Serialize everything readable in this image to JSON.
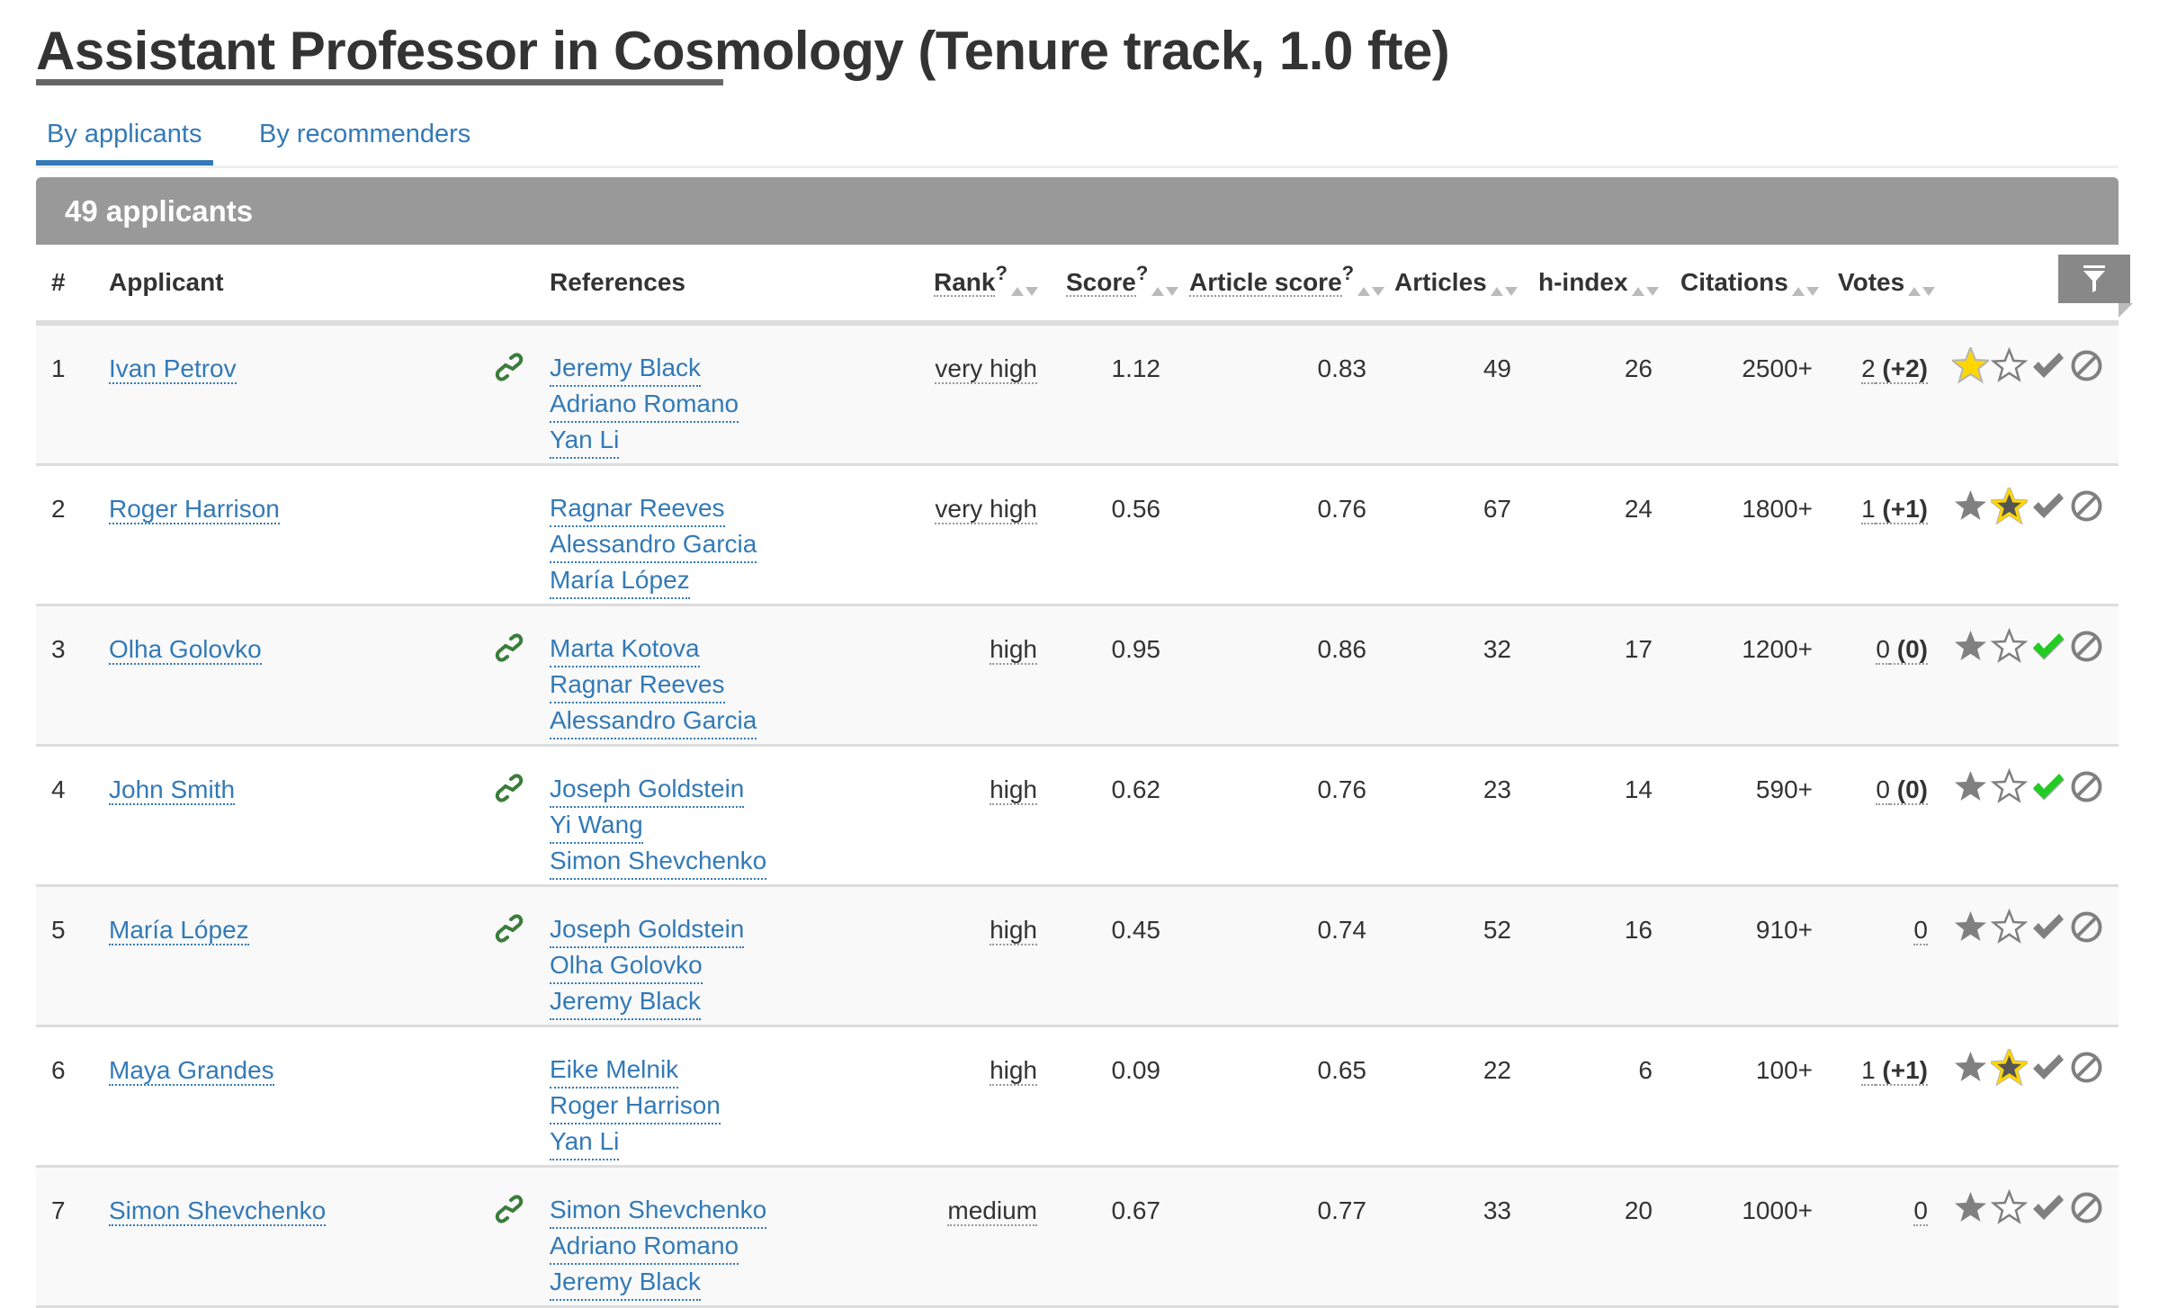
{
  "page": {
    "title": "Assistant Professor in Cosmology (Tenure track, 1.0 fte)",
    "tabs": [
      {
        "label": "By applicants",
        "active": true
      },
      {
        "label": "By recommenders",
        "active": false
      }
    ],
    "applicant_count_label": "49 applicants"
  },
  "colors": {
    "link": "#337ab7",
    "link_icon": "#3a7d3a",
    "star_yellow": "#ffd700",
    "check_green": "#22cc22",
    "icon_grey": "#808080",
    "header_bar": "#999999"
  },
  "table": {
    "headers": {
      "num": "#",
      "applicant": "Applicant",
      "references": "References",
      "rank": "Rank",
      "score": "Score",
      "article_score": "Article score",
      "articles": "Articles",
      "hindex": "h-index",
      "citations": "Citations",
      "votes": "Votes",
      "help_mark": "?"
    },
    "filter_icon": "filter-icon",
    "rows": [
      {
        "num": "1",
        "name": "Ivan Petrov",
        "has_link": true,
        "refs": [
          "Jeremy Black",
          "Adriano Romano",
          "Yan Li"
        ],
        "rank": "very high",
        "score": "1.12",
        "article_score": "0.83",
        "articles": "49",
        "hindex": "26",
        "citations": "2500+",
        "votes": "2",
        "votes_delta": "(+2)",
        "star_full": "yellow",
        "star_outline": "grey",
        "check": "grey"
      },
      {
        "num": "2",
        "name": "Roger Harrison",
        "has_link": false,
        "refs": [
          "Ragnar Reeves",
          "Alessandro Garcia",
          "María López"
        ],
        "rank": "very high",
        "score": "0.56",
        "article_score": "0.76",
        "articles": "67",
        "hindex": "24",
        "citations": "1800+",
        "votes": "1",
        "votes_delta": "(+1)",
        "star_full": "grey",
        "star_outline": "yellow",
        "check": "grey"
      },
      {
        "num": "3",
        "name": "Olha Golovko",
        "has_link": true,
        "refs": [
          "Marta Kotova",
          "Ragnar Reeves",
          "Alessandro Garcia"
        ],
        "rank": "high",
        "score": "0.95",
        "article_score": "0.86",
        "articles": "32",
        "hindex": "17",
        "citations": "1200+",
        "votes": "0",
        "votes_delta": "(0)",
        "star_full": "grey",
        "star_outline": "grey",
        "check": "green"
      },
      {
        "num": "4",
        "name": "John Smith",
        "has_link": true,
        "refs": [
          "Joseph Goldstein",
          "Yi Wang",
          "Simon Shevchenko"
        ],
        "rank": "high",
        "score": "0.62",
        "article_score": "0.76",
        "articles": "23",
        "hindex": "14",
        "citations": "590+",
        "votes": "0",
        "votes_delta": "(0)",
        "star_full": "grey",
        "star_outline": "grey",
        "check": "green"
      },
      {
        "num": "5",
        "name": "María López",
        "has_link": true,
        "refs": [
          "Joseph Goldstein",
          "Olha Golovko",
          "Jeremy Black"
        ],
        "rank": "high",
        "score": "0.45",
        "article_score": "0.74",
        "articles": "52",
        "hindex": "16",
        "citations": "910+",
        "votes": "0",
        "votes_delta": "",
        "star_full": "grey",
        "star_outline": "grey",
        "check": "grey"
      },
      {
        "num": "6",
        "name": "Maya Grandes",
        "has_link": false,
        "refs": [
          "Eike Melnik",
          "Roger Harrison",
          "Yan Li"
        ],
        "rank": "high",
        "score": "0.09",
        "article_score": "0.65",
        "articles": "22",
        "hindex": "6",
        "citations": "100+",
        "votes": "1",
        "votes_delta": "(+1)",
        "star_full": "grey",
        "star_outline": "yellow",
        "check": "grey"
      },
      {
        "num": "7",
        "name": "Simon Shevchenko",
        "has_link": true,
        "refs": [
          "Simon Shevchenko",
          "Adriano Romano",
          "Jeremy Black"
        ],
        "rank": "medium",
        "score": "0.67",
        "article_score": "0.77",
        "articles": "33",
        "hindex": "20",
        "citations": "1000+",
        "votes": "0",
        "votes_delta": "",
        "star_full": "grey",
        "star_outline": "grey",
        "check": "grey"
      }
    ]
  }
}
